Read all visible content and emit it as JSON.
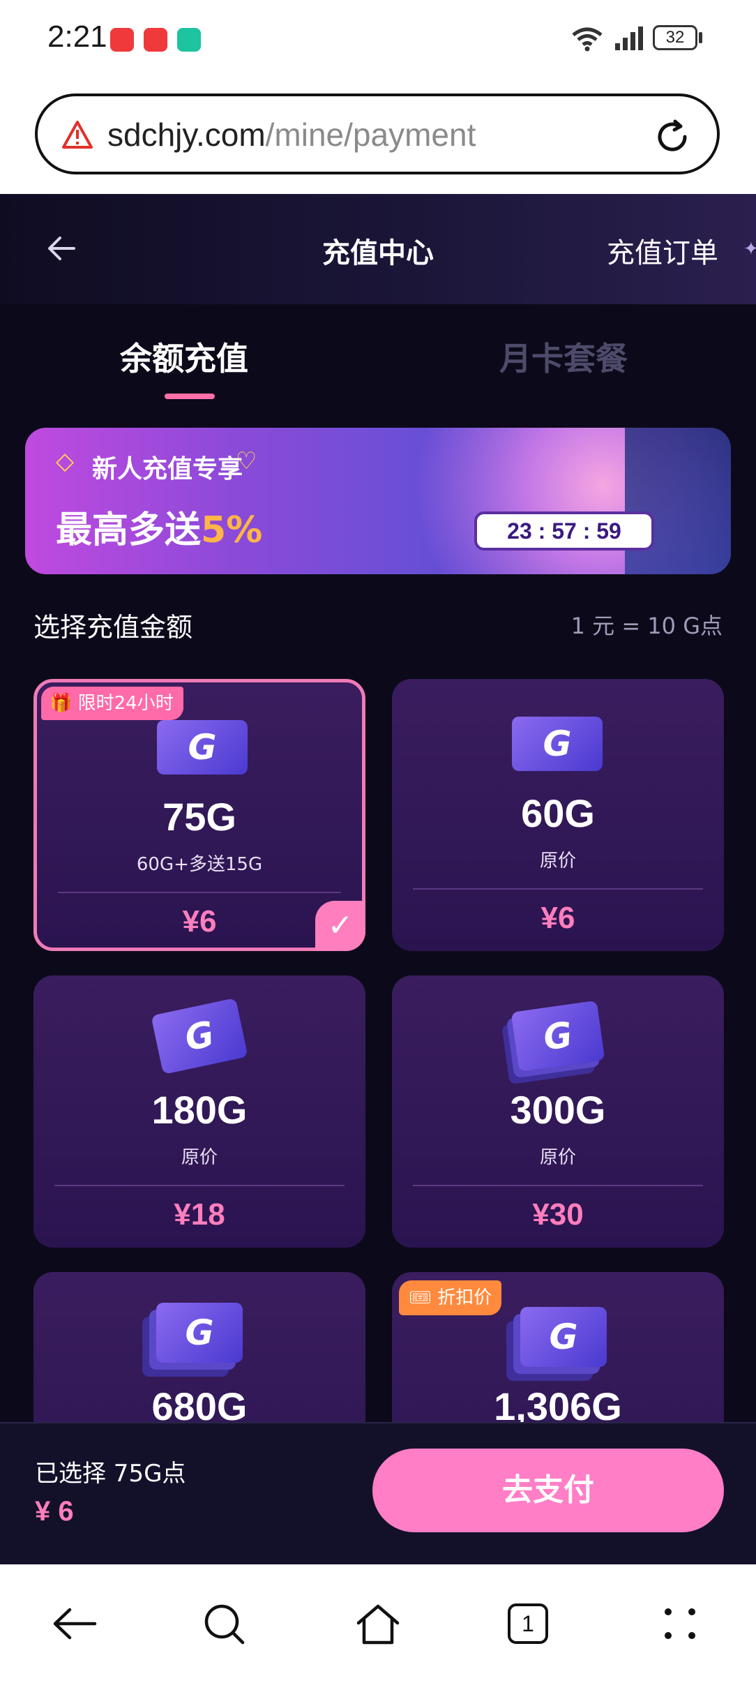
{
  "status_bar": {
    "time": "2:21",
    "battery": "32"
  },
  "url_bar": {
    "domain": "sdchjy.com",
    "path": "/mine/payment"
  },
  "header": {
    "title": "充值中心",
    "orders_link": "充值订单"
  },
  "tabs": [
    {
      "label": "余额充值",
      "active": true
    },
    {
      "label": "月卡套餐",
      "active": false
    }
  ],
  "banner": {
    "line1": "新人充值专享",
    "line2_prefix": "最高多送",
    "line2_highlight": "5%",
    "countdown": "23 : 57 : 59"
  },
  "section": {
    "title": "选择充值金额",
    "rate": "1 元 = 10 G点"
  },
  "packages": [
    {
      "badge": "限时24小时",
      "amount": "75G",
      "note": "60G+多送15G",
      "price": "¥6",
      "selected": true
    },
    {
      "badge": "",
      "amount": "60G",
      "note": "原价",
      "price": "¥6",
      "selected": false
    },
    {
      "badge": "",
      "amount": "180G",
      "note": "原价",
      "price": "¥18",
      "selected": false
    },
    {
      "badge": "",
      "amount": "300G",
      "note": "原价",
      "price": "¥30",
      "selected": false
    },
    {
      "badge": "",
      "amount": "680G",
      "note": "",
      "price": "",
      "selected": false
    },
    {
      "badge": "折扣价",
      "amount": "1,306G",
      "note": "",
      "price": "",
      "selected": false
    }
  ],
  "pay_bar": {
    "selected_label": "已选择 75G点",
    "total": "¥ 6",
    "pay_button": "去支付"
  },
  "nav_bar": {
    "tab_count": "1"
  },
  "colors": {
    "accent_pink": "#ff7ec6",
    "price_pink": "#ff7ebd",
    "background": "#0c0a1a",
    "card": "#2a1450",
    "discount_orange": "#ff8a3d"
  }
}
